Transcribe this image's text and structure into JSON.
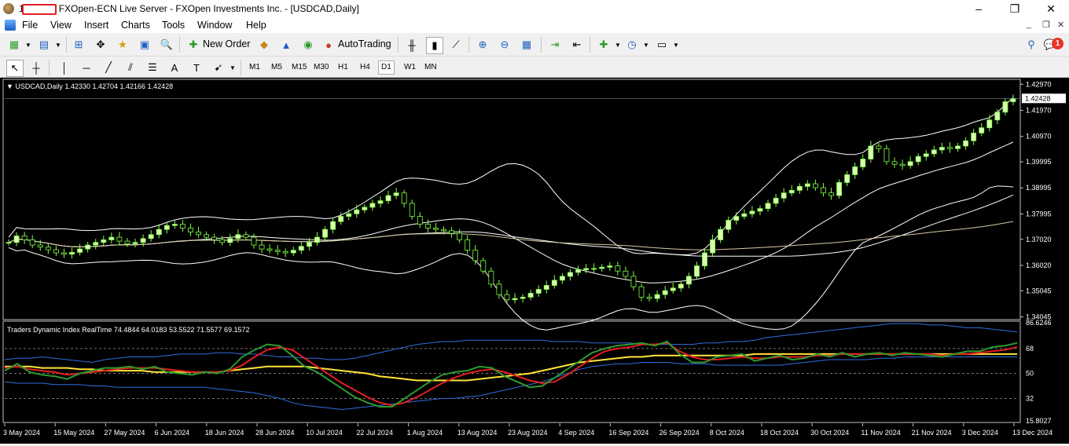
{
  "window": {
    "title_prefix": "1",
    "title": "FXOpen-ECN Live Server - FXOpen Investments Inc. - [USDCAD,Daily]",
    "controls": {
      "minimize": "–",
      "maximize": "❐",
      "close": "✕"
    }
  },
  "menu": {
    "items": [
      "File",
      "View",
      "Insert",
      "Charts",
      "Tools",
      "Window",
      "Help"
    ],
    "mdi_controls": [
      "_",
      "❐",
      "✕"
    ]
  },
  "toolbar": {
    "new_order_label": "New Order",
    "autotrading_label": "AutoTrading",
    "notification_count": "1"
  },
  "timeframes": {
    "items": [
      "M1",
      "M5",
      "M15",
      "M30",
      "H1",
      "H4",
      "D1",
      "W1",
      "MN"
    ],
    "active": "D1"
  },
  "chart_data": [
    {
      "type": "candlestick",
      "symbol_label": "USDCAD,Daily",
      "ohlc_label": "1.42330 1.42704 1.42166 1.42428",
      "last_price": "1.42428",
      "price_ticks": [
        "1.42970",
        "1.41970",
        "1.40970",
        "1.39995",
        "1.38995",
        "1.37995",
        "1.37020",
        "1.36020",
        "1.35045",
        "1.34045"
      ],
      "ylim": [
        1.34,
        1.431
      ],
      "closes": [
        1.369,
        1.3715,
        1.37,
        1.368,
        1.3672,
        1.3662,
        1.365,
        1.3645,
        1.3652,
        1.3665,
        1.368,
        1.369,
        1.37,
        1.371,
        1.3695,
        1.3685,
        1.369,
        1.3705,
        1.372,
        1.374,
        1.3755,
        1.376,
        1.3745,
        1.373,
        1.372,
        1.371,
        1.37,
        1.369,
        1.3705,
        1.372,
        1.371,
        1.368,
        1.3665,
        1.366,
        1.3655,
        1.365,
        1.366,
        1.3675,
        1.369,
        1.371,
        1.374,
        1.377,
        1.379,
        1.38,
        1.3815,
        1.3825,
        1.384,
        1.385,
        1.387,
        1.388,
        1.384,
        1.379,
        1.376,
        1.3745,
        1.374,
        1.3735,
        1.3725,
        1.37,
        1.366,
        1.362,
        1.358,
        1.353,
        1.349,
        1.347,
        1.3475,
        1.348,
        1.3495,
        1.351,
        1.3525,
        1.3545,
        1.356,
        1.3575,
        1.3585,
        1.359,
        1.359,
        1.3595,
        1.36,
        1.358,
        1.356,
        1.352,
        1.348,
        1.3475,
        1.349,
        1.3505,
        1.3515,
        1.353,
        1.356,
        1.36,
        1.365,
        1.37,
        1.374,
        1.3775,
        1.379,
        1.38,
        1.381,
        1.382,
        1.384,
        1.386,
        1.388,
        1.389,
        1.3905,
        1.3915,
        1.39,
        1.388,
        1.387,
        1.392,
        1.395,
        1.398,
        1.401,
        1.406,
        1.405,
        1.4,
        1.399,
        1.3985,
        1.4,
        1.402,
        1.403,
        1.4045,
        1.4055,
        1.405,
        1.406,
        1.408,
        1.411,
        1.413,
        1.416,
        1.419,
        1.423,
        1.4242
      ],
      "indicators": [
        "Bollinger Bands (white)",
        "Moving averages (white, beige)"
      ]
    },
    {
      "type": "line",
      "title": "Traders Dynamic Index RealTime 74.4844 64.0183 53.5522 71.5577 69.1572",
      "y_ticks": [
        "86.6246",
        "68",
        "50",
        "32",
        "15.8027"
      ],
      "ylim": [
        15.8027,
        86.6246
      ],
      "levels": [
        68,
        50,
        32
      ],
      "series": [
        {
          "color": "#2f6fe0",
          "values": [
            60,
            61,
            61,
            62,
            61,
            60,
            59,
            58,
            60,
            61,
            62,
            62,
            62,
            63,
            64,
            64,
            64,
            65,
            65,
            64,
            64,
            63,
            62,
            62,
            61,
            61,
            60,
            60,
            61,
            63,
            65,
            67,
            69,
            71,
            72,
            73,
            73,
            74,
            74,
            74,
            74,
            74,
            74,
            74,
            73,
            73,
            73,
            72,
            72,
            72,
            72,
            71,
            71,
            71,
            71,
            71,
            72,
            72,
            73,
            73,
            74,
            76,
            77,
            78,
            79,
            80,
            81,
            82,
            83,
            84,
            85,
            86,
            86,
            86,
            85,
            85,
            84,
            83,
            83,
            82,
            81,
            80
          ]
        },
        {
          "color": "#2f6fe0",
          "values": [
            44,
            43,
            43,
            43,
            42,
            42,
            42,
            41,
            41,
            40,
            40,
            40,
            40,
            40,
            40,
            40,
            40,
            39,
            38,
            37,
            36,
            34,
            32,
            29,
            27,
            26,
            25,
            24,
            25,
            26,
            27,
            28,
            29,
            30,
            31,
            32,
            32,
            33,
            34,
            36,
            38,
            40,
            42,
            44,
            47,
            50,
            53,
            55,
            56,
            57,
            57,
            58,
            58,
            58,
            57,
            57,
            57,
            56,
            56,
            56,
            56,
            56,
            56,
            57,
            58,
            59,
            60,
            60,
            60,
            60,
            61,
            61,
            62,
            62,
            62,
            62,
            62,
            62,
            62,
            62,
            62,
            62
          ]
        },
        {
          "color": "#ffe53a",
          "values": [
            55,
            55,
            55,
            54,
            54,
            54,
            53,
            53,
            52,
            52,
            52,
            52,
            51,
            51,
            51,
            51,
            51,
            51,
            52,
            53,
            54,
            55,
            55,
            55,
            55,
            54,
            53,
            52,
            51,
            50,
            48,
            47,
            46,
            45,
            45,
            45,
            45,
            45,
            46,
            47,
            48,
            49,
            50,
            52,
            54,
            56,
            58,
            59,
            60,
            61,
            62,
            62,
            63,
            63,
            63,
            63,
            63,
            63,
            63,
            63,
            64,
            64,
            64,
            64,
            64,
            64,
            64,
            64,
            64,
            64,
            64,
            64,
            64,
            64,
            64,
            64,
            64,
            64,
            64,
            64,
            64,
            64
          ]
        },
        {
          "color": "#e51e1e",
          "values": [
            54,
            55,
            53,
            52,
            51,
            49,
            50,
            51,
            52,
            53,
            54,
            54,
            54,
            53,
            52,
            51,
            51,
            51,
            52,
            56,
            62,
            67,
            69,
            67,
            61,
            55,
            49,
            43,
            38,
            33,
            29,
            27,
            29,
            33,
            38,
            43,
            47,
            50,
            52,
            53,
            51,
            48,
            45,
            43,
            44,
            49,
            55,
            61,
            66,
            68,
            69,
            71,
            71,
            72,
            66,
            62,
            60,
            60,
            61,
            62,
            61,
            61,
            62,
            62,
            62,
            63,
            63,
            64,
            64,
            64,
            64,
            64,
            64,
            64,
            64,
            63,
            64,
            64,
            65,
            66,
            67,
            69
          ]
        },
        {
          "color": "#2e9a2e",
          "values": [
            52,
            57,
            51,
            49,
            48,
            46,
            50,
            52,
            54,
            54,
            55,
            53,
            55,
            51,
            50,
            49,
            51,
            50,
            53,
            62,
            67,
            71,
            70,
            63,
            55,
            51,
            45,
            39,
            33,
            29,
            26,
            26,
            32,
            38,
            44,
            49,
            51,
            52,
            55,
            54,
            48,
            44,
            40,
            41,
            47,
            53,
            59,
            65,
            68,
            70,
            71,
            72,
            70,
            73,
            64,
            58,
            58,
            62,
            63,
            64,
            59,
            61,
            63,
            60,
            61,
            64,
            62,
            65,
            62,
            64,
            65,
            63,
            65,
            64,
            63,
            62,
            64,
            66,
            66,
            69,
            70,
            72
          ]
        }
      ]
    }
  ],
  "x_ticks": [
    "3 May 2024",
    "15 May 2024",
    "27 May 2024",
    "6 Jun 2024",
    "18 Jun 2024",
    "28 Jun 2024",
    "10 Jul 2024",
    "22 Jul 2024",
    "1 Aug 2024",
    "13 Aug 2024",
    "23 Aug 2024",
    "4 Sep 2024",
    "16 Sep 2024",
    "26 Sep 2024",
    "8 Oct 2024",
    "18 Oct 2024",
    "30 Oct 2024",
    "11 Nov 2024",
    "21 Nov 2024",
    "3 Dec 2024",
    "13 Dec 2024"
  ],
  "colors": {
    "chart_bg": "#000000",
    "axis_text": "#ffffff",
    "up_candle": "#d8ffb0",
    "down_candle": "#000000",
    "candle_outline": "#7fff40",
    "bb": "#ffffff",
    "ma": "#d8caa0"
  }
}
